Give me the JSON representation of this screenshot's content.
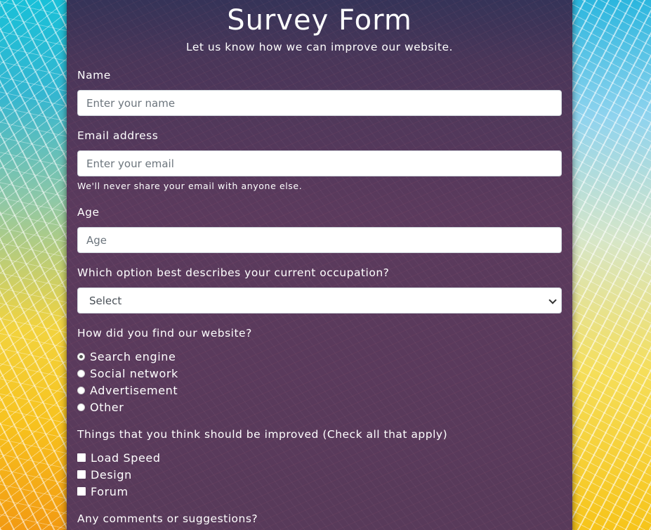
{
  "header": {
    "title": "Survey Form",
    "subtitle": "Let us know how we can improve our website."
  },
  "fields": {
    "name": {
      "label": "Name",
      "placeholder": "Enter your name",
      "value": ""
    },
    "email": {
      "label": "Email address",
      "placeholder": "Enter your email",
      "value": "",
      "help": "We'll never share your email with anyone else."
    },
    "age": {
      "label": "Age",
      "placeholder": "Age",
      "value": ""
    },
    "occupation": {
      "label": "Which option best describes your current occupation?",
      "selected": "Select"
    }
  },
  "find_website": {
    "question": "How did you find our website?",
    "selected_index": 0,
    "options": [
      "Search engine",
      "Social network",
      "Advertisement",
      "Other"
    ]
  },
  "improvements": {
    "question": "Things that you think should be improved (Check all that apply)",
    "options": [
      "Load Speed",
      "Design",
      "Forum"
    ]
  },
  "comments": {
    "label": "Any comments or suggestions?"
  },
  "colors": {
    "card_background": "#583a5a",
    "text": "#ffffff",
    "input_border": "#ced4da"
  }
}
